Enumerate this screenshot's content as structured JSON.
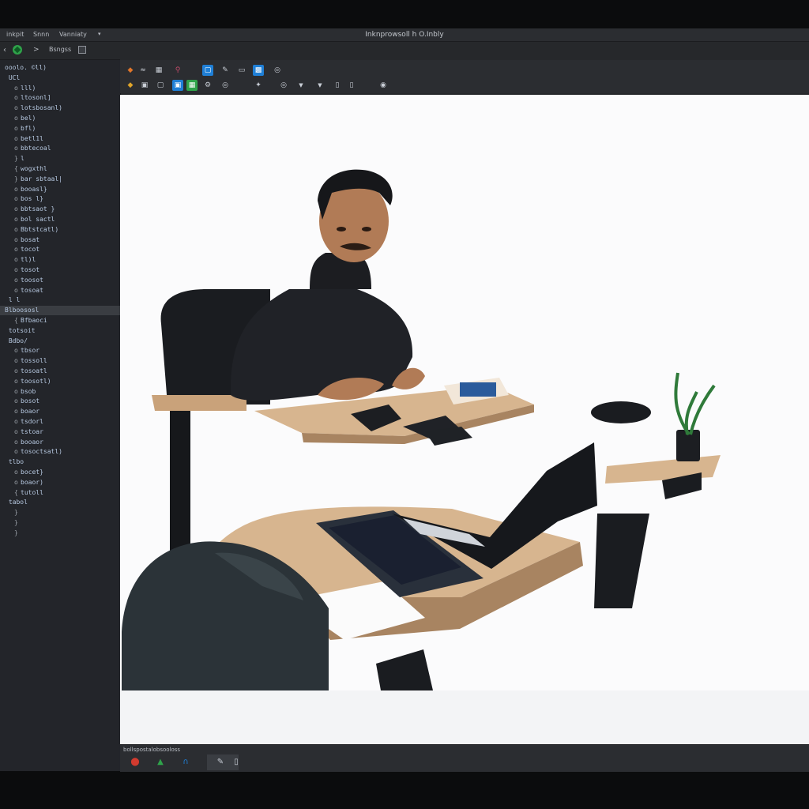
{
  "menubar": {
    "items": [
      "inkpit",
      "Snnn",
      "Vanniaty"
    ],
    "title": "Inknprowsoll h O.Inbly"
  },
  "subbar": {
    "back_glyph": "‹",
    "arrow_glyph": ">",
    "label": "Bsngss"
  },
  "sidebar": {
    "rows": [
      {
        "bullet": "",
        "text": "ooolo. ©ll)"
      },
      {
        "bullet": "",
        "text": "  UCl"
      },
      {
        "bullet": "o",
        "text": "lll)"
      },
      {
        "bullet": "o",
        "text": "ltosonl]"
      },
      {
        "bullet": "o",
        "text": "lotsbosanl)"
      },
      {
        "bullet": "o",
        "text": "bel)"
      },
      {
        "bullet": "o",
        "text": "bfl)"
      },
      {
        "bullet": "o",
        "text": "betl1l"
      },
      {
        "bullet": "o",
        "text": "bbtecoal"
      },
      {
        "bullet": "}",
        "text": "l"
      },
      {
        "bullet": "{",
        "text": "wogxthl"
      },
      {
        "bullet": "}",
        "text": "bar  sbtaal|"
      },
      {
        "bullet": "o",
        "text": "booasl}"
      },
      {
        "bullet": "o",
        "text": "bos    l}"
      },
      {
        "bullet": "o",
        "text": "bbtsaot  }"
      },
      {
        "bullet": "o",
        "text": "bol   sactl"
      },
      {
        "bullet": "o",
        "text": "Bbtstcatl)"
      },
      {
        "bullet": "o",
        "text": "bosat"
      },
      {
        "bullet": "o",
        "text": "tocot"
      },
      {
        "bullet": "o",
        "text": "tl)l"
      },
      {
        "bullet": "o",
        "text": "tosot"
      },
      {
        "bullet": "o",
        "text": "toosot"
      },
      {
        "bullet": "o",
        "text": "tosoat"
      },
      {
        "bullet": "",
        "text": "  l  l"
      },
      {
        "bullet": "",
        "text": "Blboososl"
      },
      {
        "bullet": "{",
        "text": "Bfbaoci"
      },
      {
        "bullet": "",
        "text": "  totsoit"
      },
      {
        "bullet": "",
        "text": "  Bdbo/"
      },
      {
        "bullet": "o",
        "text": "tbsor"
      },
      {
        "bullet": "o",
        "text": "tossoll"
      },
      {
        "bullet": "o",
        "text": "tosoatl"
      },
      {
        "bullet": "o",
        "text": "toosotl)"
      },
      {
        "bullet": "o",
        "text": "bsob"
      },
      {
        "bullet": "o",
        "text": "bosot"
      },
      {
        "bullet": "o",
        "text": "boaor"
      },
      {
        "bullet": "o",
        "text": "tsdorl"
      },
      {
        "bullet": "o",
        "text": "tstoar"
      },
      {
        "bullet": "o",
        "text": "booaor"
      },
      {
        "bullet": "o",
        "text": "tosoctsatl)"
      },
      {
        "bullet": "",
        "text": "  tlbo"
      },
      {
        "bullet": "o",
        "text": "bocet}"
      },
      {
        "bullet": "o",
        "text": "boaor)"
      },
      {
        "bullet": "{",
        "text": "tutoll"
      },
      {
        "bullet": "",
        "text": "  tabol"
      },
      {
        "bullet": "}",
        "text": ""
      },
      {
        "bullet": "}",
        "text": ""
      },
      {
        "bullet": "}",
        "text": ""
      }
    ],
    "selected_index": 24
  },
  "toolbar": {
    "row1": [
      "◆",
      "≈",
      "▦",
      "⚲",
      "▢",
      "✎",
      "▭",
      "▩",
      "◎"
    ],
    "row2": [
      "◆",
      "▣",
      "▢",
      "▣",
      "▦",
      "⚙",
      "◎",
      "✦",
      "◎",
      "▼",
      "▼",
      "▯",
      "▯",
      "◉"
    ]
  },
  "bottombar": {
    "label": "bollspostalobsooloss"
  },
  "colors": {
    "accent_blue": "#1f7fd6",
    "accent_green": "#2fa34a",
    "accent_orange": "#e0762a",
    "accent_red": "#d23b2f"
  }
}
